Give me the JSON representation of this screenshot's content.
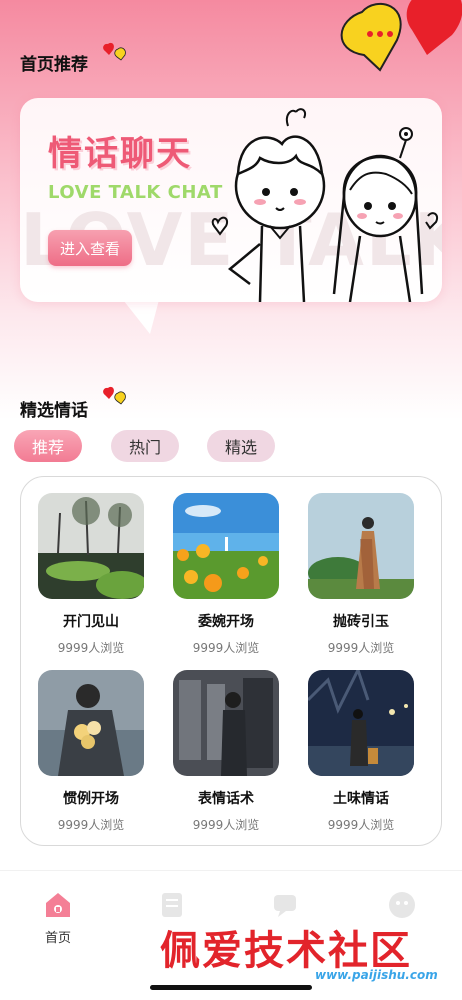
{
  "home_recommend": {
    "title": "首页推荐"
  },
  "banner": {
    "title_cn": "情话聊天",
    "title_en": "LOVE TALK CHAT",
    "button": "进入查看",
    "watermark": "LOVE TALK"
  },
  "featured": {
    "title": "精选情话"
  },
  "tabs": [
    {
      "label": "推荐",
      "active": true
    },
    {
      "label": "热门",
      "active": false
    },
    {
      "label": "精选",
      "active": false
    }
  ],
  "cards": [
    {
      "title": "开门见山",
      "count": "9999人浏览",
      "image": "garden-photo"
    },
    {
      "title": "委婉开场",
      "count": "9999人浏览",
      "image": "flower-field-photo"
    },
    {
      "title": "抛砖引玉",
      "count": "9999人浏览",
      "image": "girl-outdoors-photo"
    },
    {
      "title": "惯例开场",
      "count": "9999人浏览",
      "image": "flowers-bouquet-photo"
    },
    {
      "title": "表情话术",
      "count": "9999人浏览",
      "image": "blurred-window-photo"
    },
    {
      "title": "土味情话",
      "count": "9999人浏览",
      "image": "night-street-photo"
    }
  ],
  "bottom_nav": [
    {
      "label": "首页",
      "icon": "home-icon",
      "active": true
    },
    {
      "label": "",
      "icon": "list-icon",
      "active": false
    },
    {
      "label": "",
      "icon": "chat-icon",
      "active": false
    },
    {
      "label": "",
      "icon": "profile-icon",
      "active": false
    }
  ],
  "watermark": {
    "text": "佩爱技术社区",
    "url": "www.paijishu.com"
  },
  "colors": {
    "accent": "#ee5a76",
    "accent_light": "#f9a6b6",
    "green": "#9fd96a",
    "tab_inactive": "#f0d7e2"
  }
}
